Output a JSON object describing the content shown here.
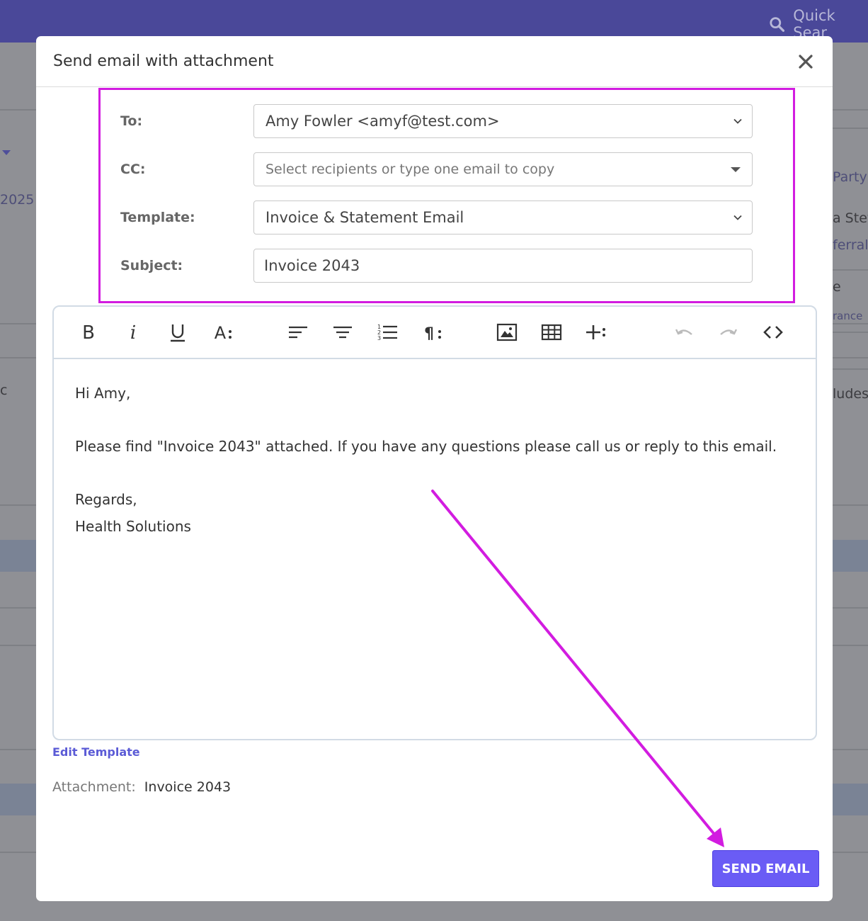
{
  "background": {
    "quick_search_label": "Quick Sear",
    "left_texts": [
      "2025",
      "c"
    ],
    "right_texts": [
      "Party",
      "a Stev",
      "ferral",
      "e",
      "rance",
      "ludes"
    ]
  },
  "modal": {
    "title": "Send email with attachment",
    "fields": {
      "to_label": "To:",
      "to_value": "Amy Fowler <amyf@test.com>",
      "cc_label": "CC:",
      "cc_placeholder": "Select recipients or type one email to copy",
      "template_label": "Template:",
      "template_value": "Invoice & Statement Email",
      "subject_label": "Subject:",
      "subject_value": "Invoice 2043"
    },
    "editor": {
      "toolbar": [
        "bold-icon",
        "italic-icon",
        "underline-icon",
        "font-size-icon",
        "align-left-icon",
        "align-center-icon",
        "ordered-list-icon",
        "paragraph-icon",
        "image-icon",
        "table-icon",
        "insert-more-icon",
        "undo-icon",
        "redo-icon",
        "code-view-icon"
      ],
      "body": {
        "greeting": "Hi Amy,",
        "message": "Please find \"Invoice 2043\" attached. If you have any questions please call us or reply to this email.",
        "closing": "Regards,",
        "signature": "Health Solutions"
      }
    },
    "edit_template_link": "Edit Template",
    "attachment_label": "Attachment:",
    "attachment_name": "Invoice 2043",
    "send_button": "SEND EMAIL"
  },
  "colors": {
    "annotation": "#d21ce0",
    "primary_button": "#6a5cf5",
    "link": "#5b5bd6",
    "topbar": "#4a4899"
  }
}
